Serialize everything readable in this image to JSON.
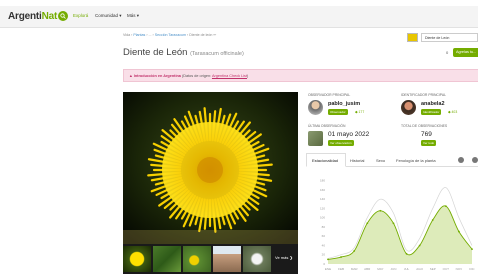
{
  "nav": {
    "logo_prefix": "Argenti",
    "logo_suffix": "Nat",
    "items": [
      {
        "label": "Explorá",
        "active": true
      },
      {
        "label": "Comunidad ▾",
        "active": false
      },
      {
        "label": "Más ▾",
        "active": false
      }
    ]
  },
  "breadcrumb": {
    "start": "Vida › ",
    "plantas": "Plantas",
    "mid": " › ... › ",
    "seccion": "Sección Taraxacum",
    "end": " › Diente de león  ✏"
  },
  "title": {
    "common": "Diente de León ",
    "scientific": "(Taraxacum officinale)"
  },
  "taxon_select": {
    "value": "Diente de León",
    "thumb_icon": "dandelion-thumb"
  },
  "add": {
    "count": "0",
    "label": "Agrelas tu..."
  },
  "banner": {
    "warning": "▲ Introducción en Argentina",
    "text": " (Datos de origen: ",
    "link": "Argentina Check List",
    "end": ")"
  },
  "photos": {
    "ver_mas": "Ve más ❯"
  },
  "stats": {
    "observador_label": "OBSERVADOR PRINCIPAL",
    "observador_name": "pablo_jusim",
    "observador_badge": "Observador",
    "observador_count": "◆ 177",
    "identificador_label": "IDENTIFICADOR PRINCIPAL",
    "identificador_name": "anabela2",
    "identificador_badge": "Identificador",
    "identificador_count": "◆ 403",
    "ultima_label": "ÚLTIMA OBSERVACIÓN",
    "ultima_value": "01 mayo 2022",
    "ultima_badge": "Ver observación",
    "total_label": "TOTAL DE OBSERVACIONES",
    "total_value": "769",
    "total_badge": "Ver todo"
  },
  "tabs": [
    "Estacionalidad",
    "Historial",
    "Sexo",
    "Fenología de la planta"
  ],
  "chart_data": {
    "type": "area",
    "categories": [
      "ENE",
      "FEB",
      "MAR",
      "ABR",
      "MAY",
      "JUN",
      "JUL",
      "AGO",
      "SEP",
      "OCT",
      "NOV",
      "DIC"
    ],
    "y_ticks": [
      0,
      20,
      40,
      60,
      80,
      100,
      120,
      140,
      160,
      180
    ],
    "ylim": [
      0,
      190
    ],
    "series": [
      {
        "values": [
          10,
          15,
          28,
          88,
          115,
          88,
          22,
          40,
          95,
          125,
          70,
          32
        ],
        "color": "#74ac00",
        "style": "filled-line"
      },
      {
        "values": [
          12,
          20,
          35,
          100,
          140,
          110,
          30,
          55,
          120,
          165,
          100,
          40
        ],
        "color": "#d5d5d5",
        "style": "line"
      }
    ]
  }
}
